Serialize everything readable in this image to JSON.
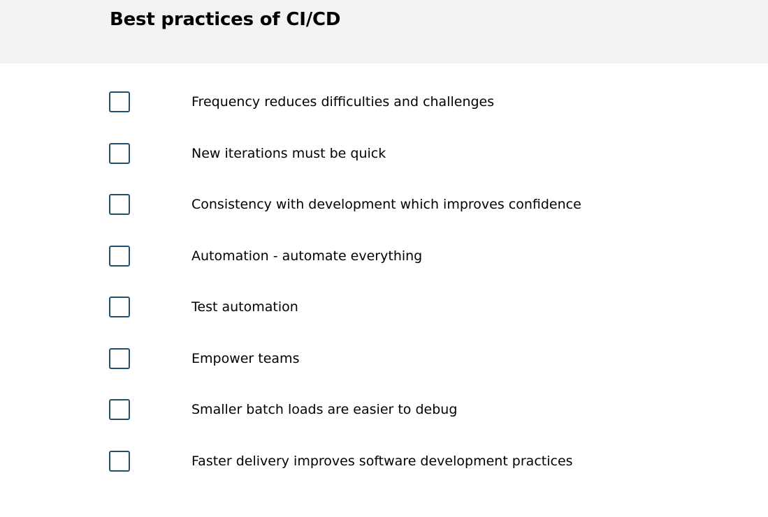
{
  "header": {
    "title": "Best practices of CI/CD"
  },
  "checklist": {
    "items": [
      {
        "label": "Frequency reduces difficulties and challenges",
        "checked": false
      },
      {
        "label": "New iterations must be quick",
        "checked": false
      },
      {
        "label": "Consistency with development which improves confidence",
        "checked": false
      },
      {
        "label": "Automation - automate everything",
        "checked": false
      },
      {
        "label": "Test automation",
        "checked": false
      },
      {
        "label": "Empower teams",
        "checked": false
      },
      {
        "label": "Smaller batch loads are easier to debug",
        "checked": false
      },
      {
        "label": "Faster delivery improves software development practices",
        "checked": false
      }
    ]
  },
  "colors": {
    "header_background": "#f2f2f2",
    "checkbox_border": "#1f4e6e",
    "text": "#000000"
  }
}
